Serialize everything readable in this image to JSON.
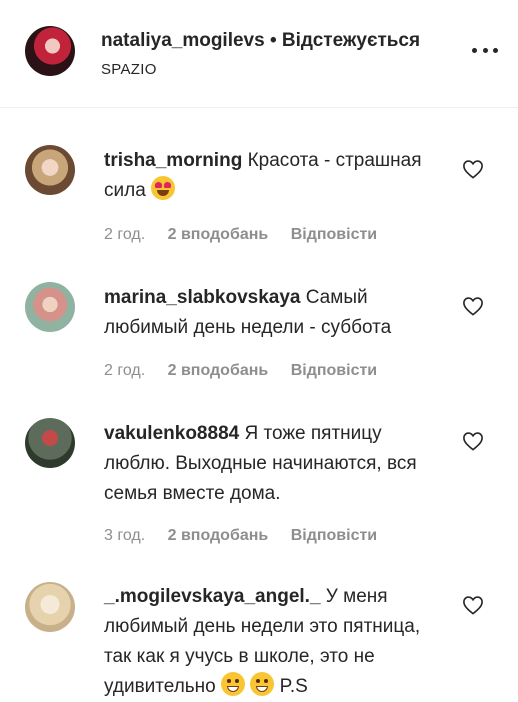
{
  "post_header": {
    "username": "nataliya_mogilevs",
    "separator": " • ",
    "follow_status": "Відстежується",
    "location": "SPAZIO",
    "more_icon": "more-horizontal-icon"
  },
  "comments": [
    {
      "username": "trisha_morning",
      "text": "Красота - страшная сила",
      "emoji": "smiling-face-with-heart-eyes",
      "time": "2 год.",
      "likes": "2 вподобань",
      "reply": "Відповісти"
    },
    {
      "username": "marina_slabkovskaya",
      "text": "Самый любимый день недели - суббота",
      "time": "2 год.",
      "likes": "2 вподобань",
      "reply": "Відповісти"
    },
    {
      "username": "vakulenko8884",
      "text": "Я тоже пятницу люблю. Выходные начинаются, вся семья вместе дома.",
      "time": "3 год.",
      "likes": "2 вподобань",
      "reply": "Відповісти"
    },
    {
      "username": "_.mogilevskaya_angel._",
      "text": "У меня любимый день недели это пятница, так как я учусь в школе, это не удивительно",
      "trailing_text": "P.S",
      "emoji": "grinning-face-emojis"
    }
  ],
  "colors": {
    "text": "#262626",
    "muted": "#8e8e8e",
    "divider": "#efefef"
  }
}
